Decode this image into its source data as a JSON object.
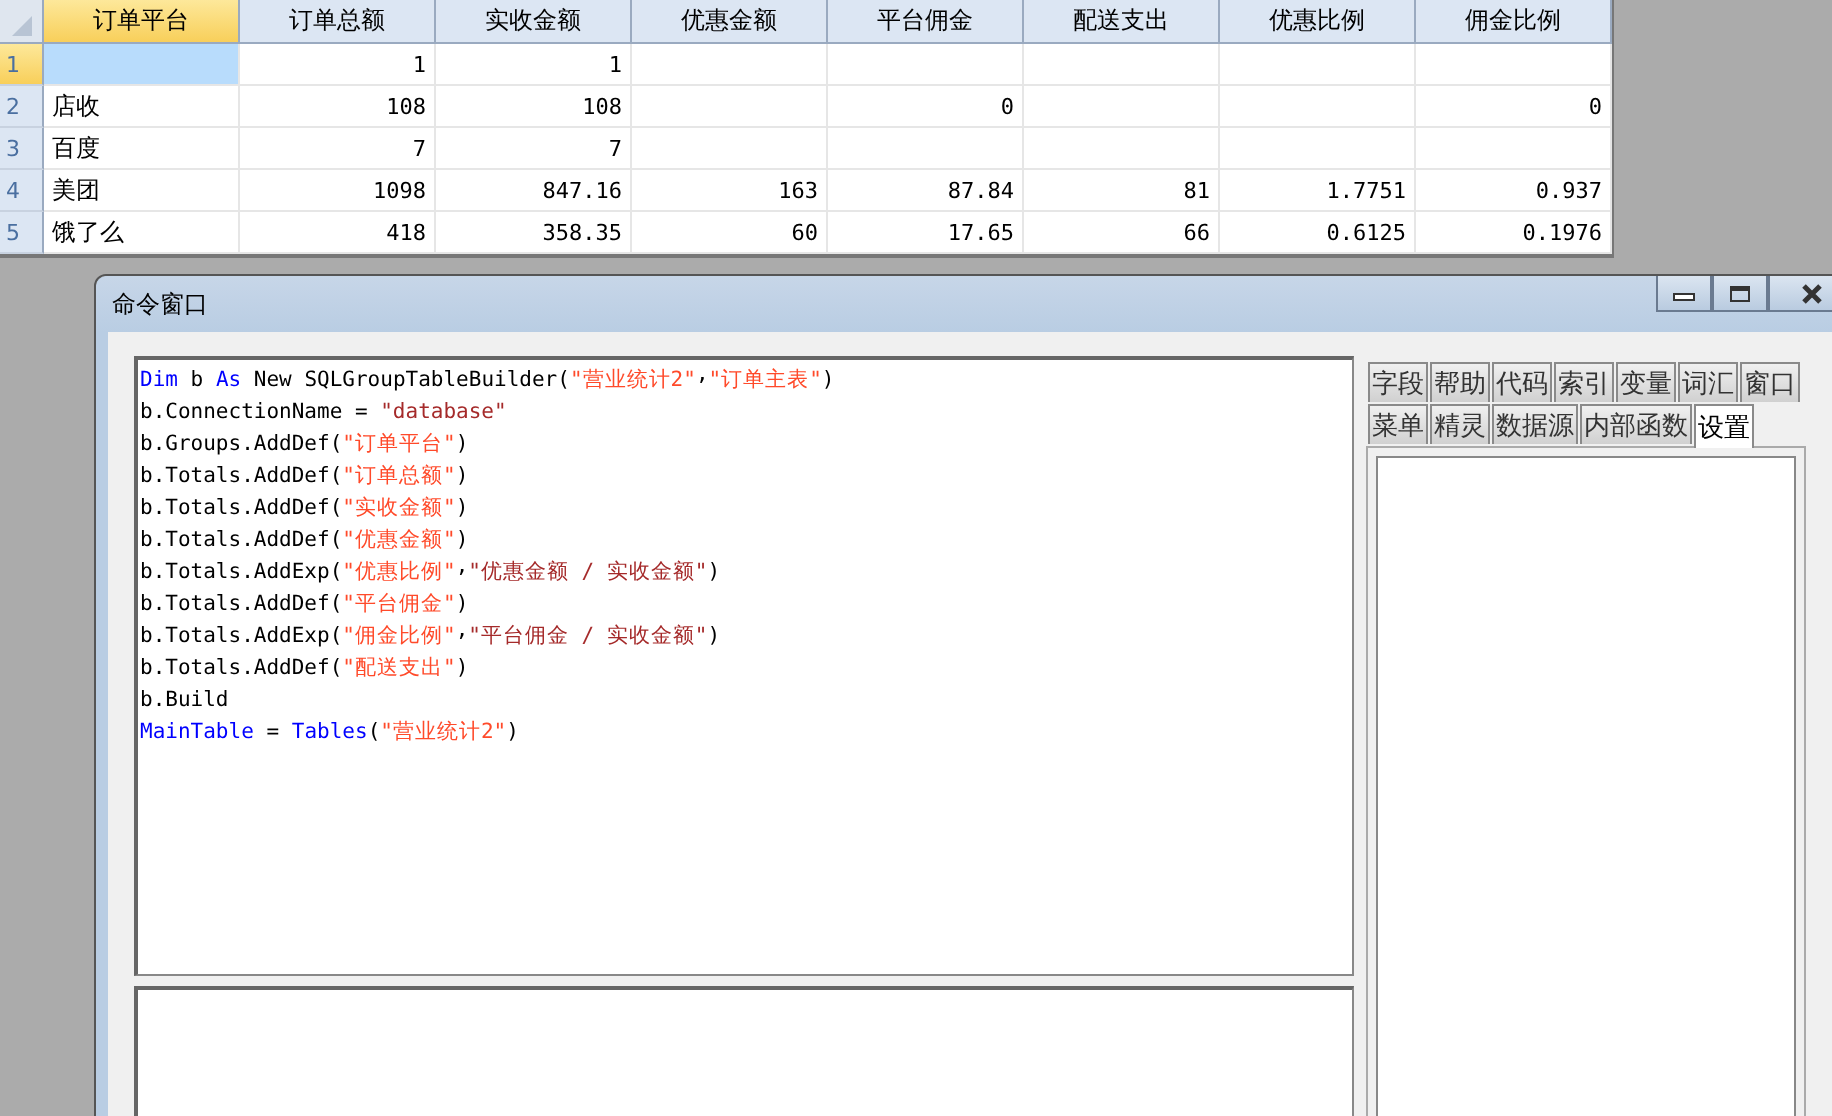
{
  "grid": {
    "columns": [
      {
        "label": "订单平台",
        "selected": true
      },
      {
        "label": "订单总额",
        "selected": false
      },
      {
        "label": "实收金额",
        "selected": false
      },
      {
        "label": "优惠金额",
        "selected": false
      },
      {
        "label": "平台佣金",
        "selected": false
      },
      {
        "label": "配送支出",
        "selected": false
      },
      {
        "label": "优惠比例",
        "selected": false
      },
      {
        "label": "佣金比例",
        "selected": false
      }
    ],
    "rows": [
      {
        "number": "1",
        "selected": true,
        "cells": [
          null,
          "1",
          "1",
          null,
          null,
          null,
          null,
          null
        ]
      },
      {
        "number": "2",
        "selected": false,
        "cells": [
          "店收",
          "108",
          "108",
          null,
          "0",
          null,
          null,
          "0"
        ]
      },
      {
        "number": "3",
        "selected": false,
        "cells": [
          "百度",
          "7",
          "7",
          null,
          null,
          null,
          null,
          null
        ]
      },
      {
        "number": "4",
        "selected": false,
        "cells": [
          "美团",
          "1098",
          "847.16",
          "163",
          "87.84",
          "81",
          "1.7751",
          "0.937"
        ]
      },
      {
        "number": "5",
        "selected": false,
        "cells": [
          "饿了么",
          "418",
          "358.35",
          "60",
          "17.65",
          "66",
          "0.6125",
          "0.1976"
        ]
      }
    ]
  },
  "window": {
    "title": "命令窗口",
    "code": [
      [
        {
          "kind": "kw",
          "text": "Dim"
        },
        {
          "kind": "txt",
          "text": " b "
        },
        {
          "kind": "kw",
          "text": "As"
        },
        {
          "kind": "txt",
          "text": " New SQLGroupTableBuilder("
        },
        {
          "kind": "str",
          "text": "\"营业统计2\""
        },
        {
          "kind": "sep",
          "text": ","
        },
        {
          "kind": "str",
          "text": "\"订单主表\""
        },
        {
          "kind": "txt",
          "text": ")"
        }
      ],
      [
        {
          "kind": "txt",
          "text": "b.ConnectionName = "
        },
        {
          "kind": "expr",
          "text": "\"database\""
        }
      ],
      [
        {
          "kind": "txt",
          "text": "b.Groups.AddDef("
        },
        {
          "kind": "str",
          "text": "\"订单平台\""
        },
        {
          "kind": "txt",
          "text": ")"
        }
      ],
      [
        {
          "kind": "txt",
          "text": "b.Totals.AddDef("
        },
        {
          "kind": "str",
          "text": "\"订单总额\""
        },
        {
          "kind": "txt",
          "text": ")"
        }
      ],
      [
        {
          "kind": "txt",
          "text": "b.Totals.AddDef("
        },
        {
          "kind": "str",
          "text": "\"实收金额\""
        },
        {
          "kind": "txt",
          "text": ")"
        }
      ],
      [
        {
          "kind": "txt",
          "text": "b.Totals.AddDef("
        },
        {
          "kind": "str",
          "text": "\"优惠金额\""
        },
        {
          "kind": "txt",
          "text": ")"
        }
      ],
      [
        {
          "kind": "txt",
          "text": "b.Totals.AddExp("
        },
        {
          "kind": "str",
          "text": "\"优惠比例\""
        },
        {
          "kind": "sep",
          "text": ","
        },
        {
          "kind": "expr",
          "text": "\"优惠金额 / 实收金额\""
        },
        {
          "kind": "txt",
          "text": ")"
        }
      ],
      [
        {
          "kind": "txt",
          "text": "b.Totals.AddDef("
        },
        {
          "kind": "str",
          "text": "\"平台佣金\""
        },
        {
          "kind": "txt",
          "text": ")"
        }
      ],
      [
        {
          "kind": "txt",
          "text": "b.Totals.AddExp("
        },
        {
          "kind": "str",
          "text": "\"佣金比例\""
        },
        {
          "kind": "sep",
          "text": ","
        },
        {
          "kind": "expr",
          "text": "\"平台佣金 / 实收金额\""
        },
        {
          "kind": "txt",
          "text": ")"
        }
      ],
      [
        {
          "kind": "txt",
          "text": "b.Totals.AddDef("
        },
        {
          "kind": "str",
          "text": "\"配送支出\""
        },
        {
          "kind": "txt",
          "text": ")"
        }
      ],
      [
        {
          "kind": "txt",
          "text": "b.Build"
        }
      ],
      [
        {
          "kind": "kw",
          "text": "MainTable"
        },
        {
          "kind": "txt",
          "text": " = "
        },
        {
          "kind": "kw",
          "text": "Tables"
        },
        {
          "kind": "txt",
          "text": "("
        },
        {
          "kind": "str",
          "text": "\"营业统计2\""
        },
        {
          "kind": "txt",
          "text": ")"
        }
      ]
    ],
    "tab_rows": [
      [
        {
          "label": "字段",
          "selected": false
        },
        {
          "label": "帮助",
          "selected": false
        },
        {
          "label": "代码",
          "selected": false
        },
        {
          "label": "索引",
          "selected": false
        },
        {
          "label": "变量",
          "selected": false
        },
        {
          "label": "词汇",
          "selected": false
        },
        {
          "label": "窗口",
          "selected": false
        }
      ],
      [
        {
          "label": "菜单",
          "selected": false
        },
        {
          "label": "精灵",
          "selected": false
        },
        {
          "label": "数据源",
          "selected": false
        },
        {
          "label": "内部函数",
          "selected": false
        },
        {
          "label": "设置",
          "selected": true
        }
      ]
    ]
  }
}
